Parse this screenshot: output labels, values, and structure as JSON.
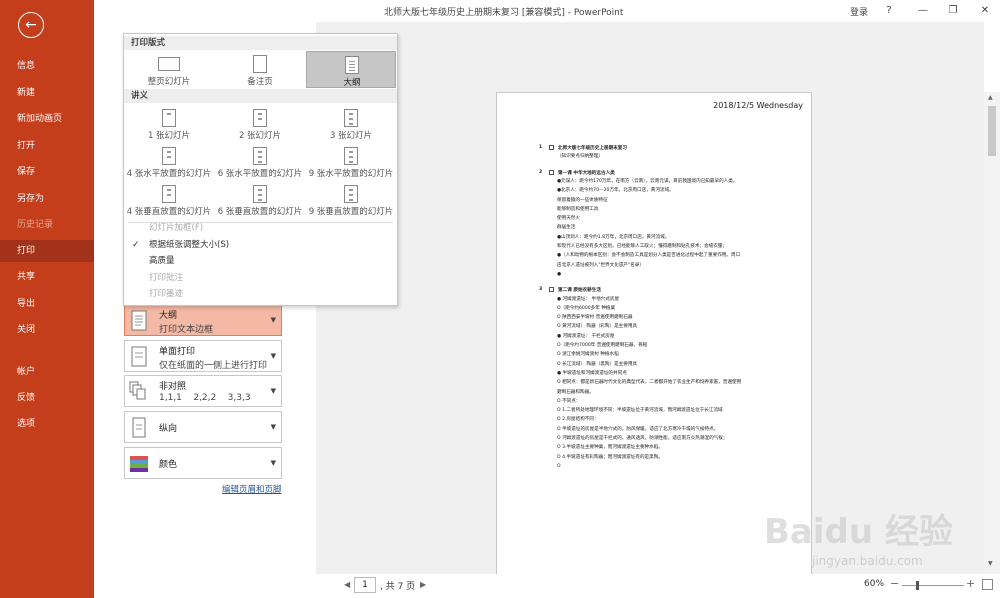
{
  "colors": {
    "nav_bg": "#c43e1c",
    "nav_active": "#a3321a",
    "selected_setting": "#f4b9a5",
    "link": "#2b5797"
  },
  "titlebar": {
    "title": "北师大版七年级历史上册期末复习 [兼容模式] - PowerPoint",
    "signin": "登录",
    "help": "?",
    "minimize": "—",
    "restore": "❐",
    "close": "✕"
  },
  "nav": {
    "back_icon": "arrow-left-icon",
    "items": [
      {
        "label": "信息"
      },
      {
        "label": "新建"
      },
      {
        "label": "新加动画页"
      },
      {
        "label": "打开"
      },
      {
        "label": "保存"
      },
      {
        "label": "另存为"
      },
      {
        "label": "历史记录"
      },
      {
        "label": "打印"
      },
      {
        "label": "共享"
      },
      {
        "label": "导出"
      },
      {
        "label": "关闭"
      },
      {
        "label": "帐户"
      },
      {
        "label": "反馈"
      },
      {
        "label": "选项"
      }
    ],
    "active": "打印"
  },
  "dropdown": {
    "section_layout": "打印版式",
    "layouts": [
      {
        "label": "整页幻灯片"
      },
      {
        "label": "备注页"
      },
      {
        "label": "大纲",
        "selected": true
      }
    ],
    "section_handouts": "讲义",
    "handouts": [
      {
        "label": "1 张幻灯片"
      },
      {
        "label": "2 张幻灯片"
      },
      {
        "label": "3 张幻灯片"
      },
      {
        "label": "4 张水平放置的幻灯片"
      },
      {
        "label": "6 张水平放置的幻灯片"
      },
      {
        "label": "9 张水平放置的幻灯片"
      },
      {
        "label": "4 张垂直放置的幻灯片"
      },
      {
        "label": "6 张垂直放置的幻灯片"
      },
      {
        "label": "9 张垂直放置的幻灯片"
      }
    ],
    "options": [
      {
        "label": "幻灯片加框(F)",
        "disabled": true,
        "checked": false
      },
      {
        "label": "根据纸张调整大小(S)",
        "disabled": false,
        "checked": true
      },
      {
        "label": "高质量",
        "disabled": false,
        "checked": false
      },
      {
        "label": "打印批注",
        "disabled": true,
        "checked": false
      },
      {
        "label": "打印墨迹",
        "disabled": true,
        "checked": false
      }
    ]
  },
  "settings": {
    "layout": {
      "title": "大纲",
      "sub": "打印文本边框"
    },
    "sides": {
      "title": "单面打印",
      "sub": "仅在纸面的一侧上进行打印"
    },
    "collate": {
      "title": "非对照",
      "sub": "1,1,1    2,2,2    3,3,3"
    },
    "orientation": {
      "title": "纵向"
    },
    "color": {
      "title": "颜色"
    },
    "edit_link": "编辑页眉和页脚"
  },
  "preview": {
    "date": "2018/12/5 Wednesday",
    "lines": [
      {
        "num": "1",
        "box": true,
        "h": true,
        "text": "北师大版七年级历史上册期末复习"
      },
      {
        "text": "（知识要点归纳整理）"
      },
      {
        "num": "2",
        "box": true,
        "h": true,
        "text": "第一课 中华大地的远古人类"
      },
      {
        "text": "●元谋人：距今约170万年，在南方（云南），云南元谋，目前我国境内已知最早的人类。"
      },
      {
        "text": "●北京人：距今约70—20万年，北京周口店，黄河流域。"
      },
      {
        "text": "保留着猿的一些体质特征"
      },
      {
        "text": "能够制造和使用工具"
      },
      {
        "text": "使用天然火"
      },
      {
        "text": "群居生活"
      },
      {
        "text": "●山顶洞人：距今约1.8万年，北京周口店，黄河流域。"
      },
      {
        "text": "和现代人已经没有多大区别。已经能够人工取火；懂得磨制和钻孔技术；会缝衣服；"
      },
      {
        "text": "●（人和动物的根本区别：会不会制造工具是划分人类是否进化过程中起了重要作用。周口"
      },
      {
        "text": "店北京人遗址被列入\"世界文化遗产\"名录）"
      },
      {
        "text": "●"
      },
      {
        "num": "3",
        "box": true,
        "h": true,
        "text": "第二课 原始农耕生活"
      },
      {
        "text": "● 河姆渡遗址：        半地穴式房屋"
      },
      {
        "text": "O（距今约6000多年    种植粟"
      },
      {
        "text": "O 陕西西安半坡村    普遍使用磨制石器"
      },
      {
        "text": "O 黄河流域）         陶器（彩陶）是主要用具"
      },
      {
        "text": "● 河姆渡遗址：        干栏式房屋"
      },
      {
        "text": "O（距今约7000年    普遍使用磨制石器，骨耜"
      },
      {
        "text": "O 浙江余姚河姆渡村    种植水稻"
      },
      {
        "text": "O 长江流域）         陶器（黑陶）是主要用具"
      },
      {
        "text": "● 半坡遗址和河姆渡遗址的共同点"
      },
      {
        "text": "O 相同点：都是新石器时代文化的典型代表，二者都开始了农业生产和饲养家畜，普遍使用"
      },
      {
        "text": "磨制石器和陶器。"
      },
      {
        "text": "O 不同点："
      },
      {
        "text": "O 1.二者所处地理环境不同：半坡遗址位于黄河流域，而河姆渡遗址位于长江流域"
      },
      {
        "text": "O 2.房屋结构不同："
      },
      {
        "text": "O 半坡遗址的房屋是半地穴式的，防风保暖，适应了北方寒冷干燥的气候特点，"
      },
      {
        "text": "O 河姆渡遗址的房屋是干栏式的，通风透风，防潮性能，适应南方炎热潮湿的气候；"
      },
      {
        "text": "O 3.半坡遗址主要种粟，而河姆渡遗址主要种水稻。"
      },
      {
        "text": "O 4.半坡遗址有彩陶器；而河姆渡遗址有的是黑陶。"
      },
      {
        "text": "O"
      }
    ]
  },
  "pager": {
    "current": "1",
    "total": ", 共 7 页",
    "prev": "◀",
    "next": "▶"
  },
  "zoom": {
    "percent": "60%",
    "level": 0.6,
    "minus": "−",
    "plus": "+"
  },
  "watermark": {
    "main": "Baidu 经验",
    "sub": "jingyan.baidu.com"
  }
}
